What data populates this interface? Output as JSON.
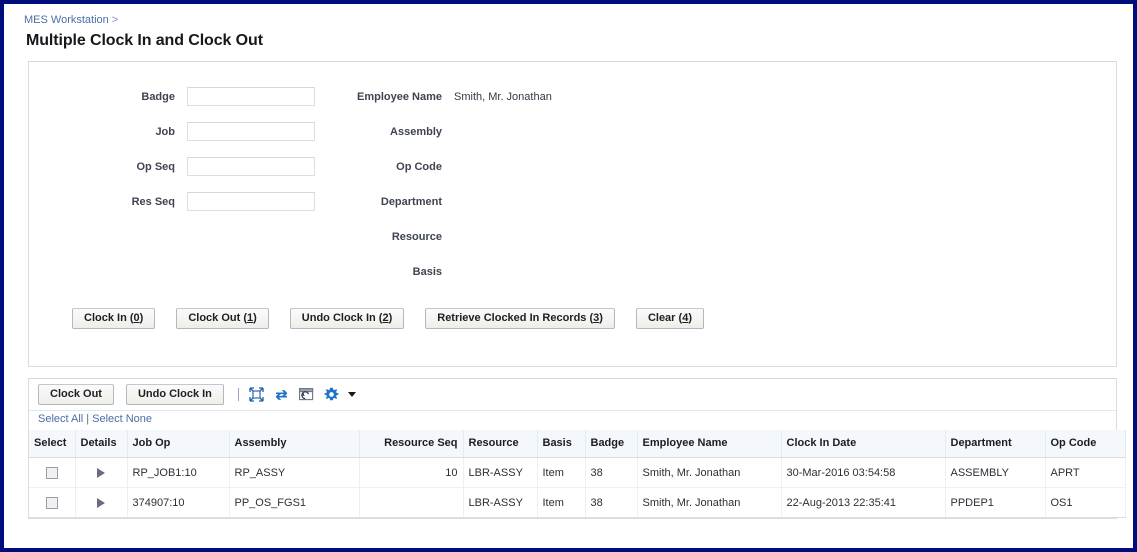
{
  "breadcrumb": {
    "link_label": "MES Workstation",
    "separator": ">"
  },
  "page_title": "Multiple Clock In and Clock Out",
  "form": {
    "left_fields": [
      {
        "label": "Badge",
        "value": "",
        "placeholder": ""
      },
      {
        "label": "Job",
        "value": "",
        "placeholder": ""
      },
      {
        "label": "Op Seq",
        "value": "",
        "placeholder": ""
      },
      {
        "label": "Res Seq",
        "value": "",
        "placeholder": ""
      }
    ],
    "right_fields": [
      {
        "label": "Employee Name",
        "value": "Smith, Mr. Jonathan"
      },
      {
        "label": "Assembly",
        "value": ""
      },
      {
        "label": "Op Code",
        "value": ""
      },
      {
        "label": "Department",
        "value": ""
      },
      {
        "label": "Resource",
        "value": ""
      },
      {
        "label": "Basis",
        "value": ""
      }
    ],
    "buttons": [
      {
        "text": "Clock In (",
        "key": "0",
        "tail": ")"
      },
      {
        "text": "Clock Out (",
        "key": "1",
        "tail": ")"
      },
      {
        "text": "Undo Clock In (",
        "key": "2",
        "tail": ")"
      },
      {
        "text": "Retrieve Clocked In Records (",
        "key": "3",
        "tail": ")"
      },
      {
        "text": "Clear (",
        "key": "4",
        "tail": ")"
      }
    ]
  },
  "results": {
    "toolbar": {
      "clock_out_label": "Clock Out",
      "undo_clock_in_label": "Undo Clock In",
      "icons": [
        "expand-all-icon",
        "refresh-icon",
        "detach-icon",
        "gear-icon"
      ]
    },
    "select_all_label": "Select All",
    "select_separator": "|",
    "select_none_label": "Select None",
    "columns": [
      {
        "label": "Select",
        "align": "center"
      },
      {
        "label": "Details",
        "align": "center"
      },
      {
        "label": "Job Op",
        "align": "left"
      },
      {
        "label": "Assembly",
        "align": "left"
      },
      {
        "label": "Resource Seq",
        "align": "right"
      },
      {
        "label": "Resource",
        "align": "left"
      },
      {
        "label": "Basis",
        "align": "left"
      },
      {
        "label": "Badge",
        "align": "left"
      },
      {
        "label": "Employee Name",
        "align": "left"
      },
      {
        "label": "Clock In Date",
        "align": "left"
      },
      {
        "label": "Department",
        "align": "left"
      },
      {
        "label": "Op Code",
        "align": "left"
      }
    ],
    "rows": [
      {
        "selected": false,
        "job_op": "RP_JOB1:10",
        "assembly": "RP_ASSY",
        "resource_seq": "10",
        "resource": "LBR-ASSY",
        "basis": "Item",
        "badge": "38",
        "employee_name": "Smith, Mr. Jonathan",
        "clock_in_date": "30-Mar-2016 03:54:58",
        "department": "ASSEMBLY",
        "op_code": "APRT"
      },
      {
        "selected": false,
        "job_op": "374907:10",
        "assembly": "PP_OS_FGS1",
        "resource_seq": "",
        "resource": "LBR-ASSY",
        "basis": "Item",
        "badge": "38",
        "employee_name": "Smith, Mr. Jonathan",
        "clock_in_date": "22-Aug-2013 22:35:41",
        "department": "PPDEP1",
        "op_code": "OS1"
      }
    ]
  },
  "colors": {
    "frame": "#000e7d",
    "link": "#4a6fa5",
    "icon_blue": "#1e6fc4",
    "header_bg": "#f4f8fc"
  }
}
